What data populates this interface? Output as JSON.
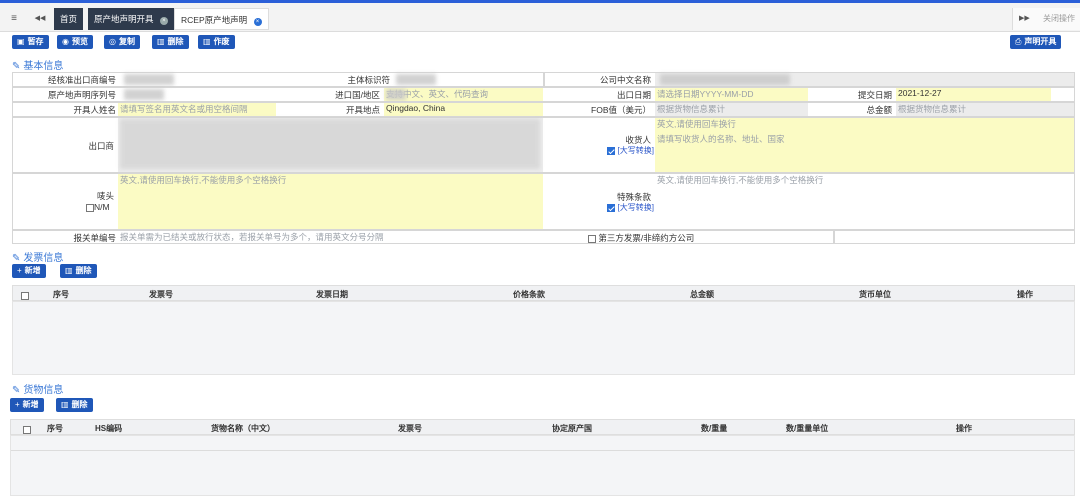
{
  "tabbar": {
    "menu_icon": "≡",
    "back_icon": "◀◀",
    "tabs": [
      {
        "label": "首页"
      },
      {
        "label": "原产地声明开具"
      },
      {
        "label": "RCEP原产地声明"
      }
    ],
    "forward_icon": "▶▶",
    "close_ops_label": "关闭操作"
  },
  "toolbar": {
    "save": "暂存",
    "preview": "预览",
    "copy": "复制",
    "delete": "删除",
    "void": "作废",
    "declare": "声明开具"
  },
  "basic_info": {
    "title": "基本信息",
    "fields": {
      "approved_exporter_no_label": "经核准出口商编号",
      "subject_id_label": "主体标识符",
      "company_cn_name_label": "公司中文名称",
      "declaration_serial_label": "原产地声明序列号",
      "import_country_label": "进口国/地区",
      "import_country_placeholder": "支持中文、英文、代码查询",
      "export_date_label": "出口日期",
      "export_date_placeholder": "请选择日期YYYY-MM-DD",
      "submit_date_label": "提交日期",
      "submit_date_value": "2021-12-27",
      "issuer_name_label": "开具人姓名",
      "issuer_name_placeholder": "请填写签名用英文名或用空格间隔",
      "issue_place_label": "开具地点",
      "issue_place_value": "Qingdao, China",
      "fob_label": "FOB值（美元）",
      "fob_placeholder": "根据货物信息累计",
      "total_label": "总金额",
      "total_placeholder": "根据货物信息累计",
      "exporter_label": "出口商",
      "consignee_label": "收货人",
      "consignee_uppercase": "[大写转换]",
      "consignee_placeholder_1": "英文,请使用回车换行",
      "consignee_placeholder_2": "请填写收货人的名称、地址、国家",
      "mark_label": "唛头",
      "mark_nm": "N/M",
      "mark_placeholder": "英文,请使用回车换行,不能使用多个空格换行",
      "special_terms_label": "特殊条款",
      "special_terms_uppercase": "[大写转换]",
      "special_terms_placeholder": "英文,请使用回车换行,不能使用多个空格换行",
      "customs_no_label": "报关单编号",
      "customs_no_placeholder": "报关单需为已结关或放行状态，若报关单号为多个，请用英文分号分隔",
      "third_party_label": "第三方发票/非缔约方公司"
    }
  },
  "invoice": {
    "title": "发票信息",
    "add": "新增",
    "delete": "删除",
    "columns": [
      "序号",
      "发票号",
      "发票日期",
      "价格条款",
      "总金额",
      "货币单位",
      "操作"
    ]
  },
  "goods": {
    "title": "货物信息",
    "add": "新增",
    "delete": "删除",
    "columns": [
      "序号",
      "HS编码",
      "货物名称（中文）",
      "发票号",
      "协定原产国",
      "数/重量",
      "数/重量单位",
      "操作"
    ]
  },
  "colors": {
    "accent": "#1f57b8",
    "section_title": "#3a78d6",
    "required_field": "#fbfbc4",
    "tab_dark": "#2e3a4c"
  }
}
